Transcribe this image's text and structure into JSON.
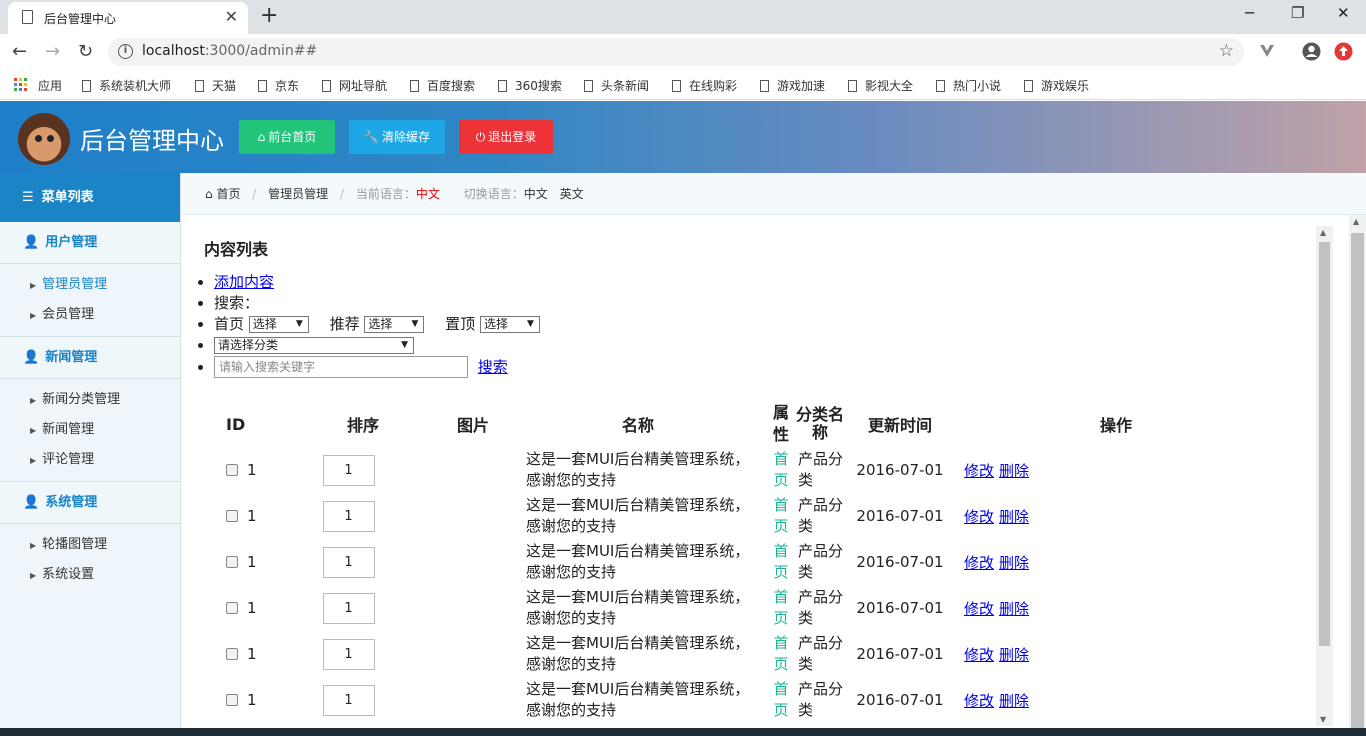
{
  "browser": {
    "tab_title": "后台管理中心",
    "url_host": "localhost",
    "url_rest": ":3000/admin##",
    "bookmarks": [
      "应用",
      "系统装机大师",
      "天猫",
      "京东",
      "网址导航",
      "百度搜索",
      "360搜索",
      "头条新闻",
      "在线购彩",
      "游戏加速",
      "影视大全",
      "热门小说",
      "游戏娱乐"
    ]
  },
  "header": {
    "brand": "后台管理中心",
    "btn_home": "前台首页",
    "btn_cache": "清除缓存",
    "btn_logout": "退出登录",
    "colors": {
      "home": "#22c47a",
      "cache": "#1ea7e6",
      "logout": "#ed3338"
    }
  },
  "sidebar": {
    "menu_title": "菜单列表",
    "sections": [
      {
        "title": "用户管理",
        "items": [
          "管理员管理",
          "会员管理"
        ]
      },
      {
        "title": "新闻管理",
        "items": [
          "新闻分类管理",
          "新闻管理",
          "评论管理"
        ]
      },
      {
        "title": "系统管理",
        "items": [
          "轮播图管理",
          "系统设置"
        ]
      }
    ]
  },
  "breadcrumb": {
    "home": "首页",
    "page": "管理员管理",
    "lang_label": "当前语言：",
    "lang_current": "中文",
    "switch_label": "切换语言：",
    "lang_zh": "中文",
    "lang_en": "英文"
  },
  "content": {
    "title": "内容列表",
    "add_link": "添加内容",
    "search_label": "搜索：",
    "filter_home": "首页",
    "filter_recommend": "推荐",
    "filter_top": "置顶",
    "select_placeholder": "选择",
    "category_placeholder": "请选择分类",
    "search_placeholder": "请输入搜索关键字",
    "search_link": "搜索"
  },
  "table": {
    "headers": {
      "id": "ID",
      "order": "排序",
      "image": "图片",
      "name": "名称",
      "attr": "属性",
      "category": "分类名称",
      "updated": "更新时间",
      "ops": "操作"
    },
    "rows": [
      {
        "id": "1",
        "order": "1",
        "name": "这是一套MUI后台精美管理系统，感谢您的支持",
        "attr": "首页",
        "category": "产品分类",
        "updated": "2016-07-01",
        "edit": "修改",
        "del": "删除"
      },
      {
        "id": "1",
        "order": "1",
        "name": "这是一套MUI后台精美管理系统，感谢您的支持",
        "attr": "首页",
        "category": "产品分类",
        "updated": "2016-07-01",
        "edit": "修改",
        "del": "删除"
      },
      {
        "id": "1",
        "order": "1",
        "name": "这是一套MUI后台精美管理系统，感谢您的支持",
        "attr": "首页",
        "category": "产品分类",
        "updated": "2016-07-01",
        "edit": "修改",
        "del": "删除"
      },
      {
        "id": "1",
        "order": "1",
        "name": "这是一套MUI后台精美管理系统，感谢您的支持",
        "attr": "首页",
        "category": "产品分类",
        "updated": "2016-07-01",
        "edit": "修改",
        "del": "删除"
      },
      {
        "id": "1",
        "order": "1",
        "name": "这是一套MUI后台精美管理系统，感谢您的支持",
        "attr": "首页",
        "category": "产品分类",
        "updated": "2016-07-01",
        "edit": "修改",
        "del": "删除"
      },
      {
        "id": "1",
        "order": "1",
        "name": "这是一套MUI后台精美管理系统，感谢您的支持",
        "attr": "首页",
        "category": "产品分类",
        "updated": "2016-07-01",
        "edit": "修改",
        "del": "删除"
      }
    ]
  }
}
